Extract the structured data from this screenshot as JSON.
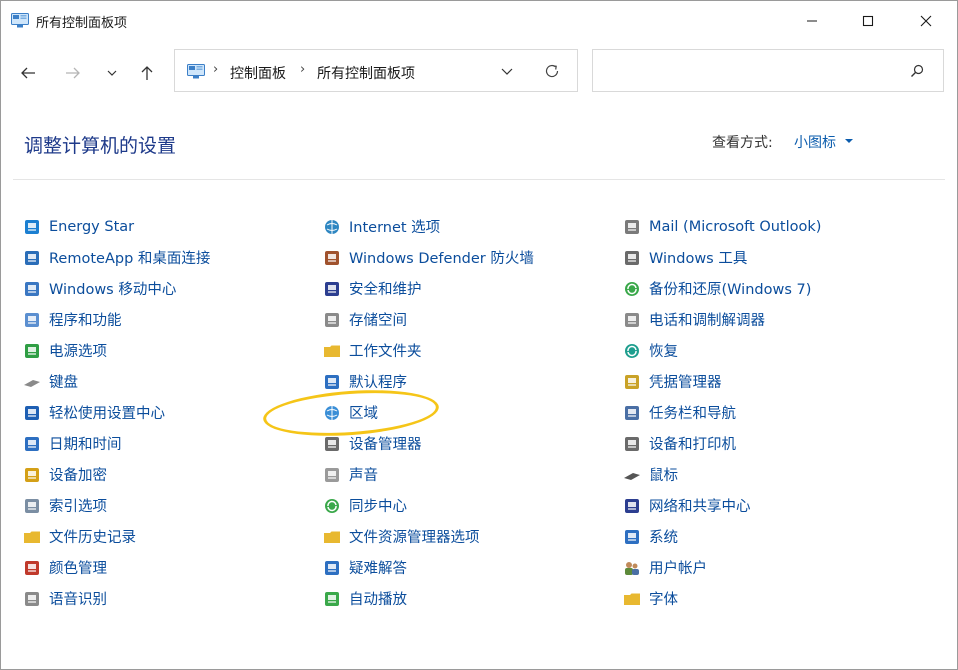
{
  "window": {
    "title": "所有控制面板项"
  },
  "address": {
    "crumbs": [
      "控制面板",
      "所有控制面板项"
    ],
    "separator": "›"
  },
  "search": {
    "placeholder": ""
  },
  "header": {
    "title": "调整计算机的设置",
    "view_label": "查看方式:",
    "view_value": "小图标"
  },
  "columns": [
    [
      {
        "label": "Energy Star",
        "icon": "energy-star-icon",
        "color": "#1b7fd1"
      },
      {
        "label": "RemoteApp 和桌面连接",
        "icon": "remoteapp-icon",
        "color": "#2a6db8"
      },
      {
        "label": "Windows 移动中心",
        "icon": "mobility-center-icon",
        "color": "#3a77c2"
      },
      {
        "label": "程序和功能",
        "icon": "programs-icon",
        "color": "#5b8fd0"
      },
      {
        "label": "电源选项",
        "icon": "power-options-icon",
        "color": "#2f9e44"
      },
      {
        "label": "键盘",
        "icon": "keyboard-icon",
        "color": "#8a8a8a"
      },
      {
        "label": "轻松使用设置中心",
        "icon": "ease-of-access-icon",
        "color": "#1e5fb3"
      },
      {
        "label": "日期和时间",
        "icon": "date-time-icon",
        "color": "#2d6fc1"
      },
      {
        "label": "设备加密",
        "icon": "device-encryption-icon",
        "color": "#d4a017"
      },
      {
        "label": "索引选项",
        "icon": "indexing-options-icon",
        "color": "#7b8ea3"
      },
      {
        "label": "文件历史记录",
        "icon": "file-history-icon",
        "color": "#e8b830"
      },
      {
        "label": "颜色管理",
        "icon": "color-management-icon",
        "color": "#c0392b"
      },
      {
        "label": "语音识别",
        "icon": "speech-recognition-icon",
        "color": "#8a8a8a"
      }
    ],
    [
      {
        "label": "Internet 选项",
        "icon": "internet-options-icon",
        "color": "#2e86c1"
      },
      {
        "label": "Windows Defender 防火墙",
        "icon": "firewall-icon",
        "color": "#a0522d"
      },
      {
        "label": "安全和维护",
        "icon": "security-maintenance-icon",
        "color": "#2c3e90"
      },
      {
        "label": "存储空间",
        "icon": "storage-spaces-icon",
        "color": "#8a8a8a"
      },
      {
        "label": "工作文件夹",
        "icon": "work-folders-icon",
        "color": "#e8b830"
      },
      {
        "label": "默认程序",
        "icon": "default-programs-icon",
        "color": "#2d6fc1"
      },
      {
        "label": "区域",
        "icon": "region-icon",
        "color": "#3a8ed6"
      },
      {
        "label": "设备管理器",
        "icon": "device-manager-icon",
        "color": "#6a6a6a"
      },
      {
        "label": "声音",
        "icon": "sound-icon",
        "color": "#9a9a9a"
      },
      {
        "label": "同步中心",
        "icon": "sync-center-icon",
        "color": "#3aa84a"
      },
      {
        "label": "文件资源管理器选项",
        "icon": "explorer-options-icon",
        "color": "#e8b830"
      },
      {
        "label": "疑难解答",
        "icon": "troubleshooting-icon",
        "color": "#2d6fc1"
      },
      {
        "label": "自动播放",
        "icon": "autoplay-icon",
        "color": "#3aa84a"
      }
    ],
    [
      {
        "label": "Mail (Microsoft Outlook)",
        "icon": "mail-icon",
        "color": "#7a7a7a"
      },
      {
        "label": "Windows 工具",
        "icon": "windows-tools-icon",
        "color": "#6a6a6a"
      },
      {
        "label": "备份和还原(Windows 7)",
        "icon": "backup-restore-icon",
        "color": "#3aa84a"
      },
      {
        "label": "电话和调制解调器",
        "icon": "phone-modem-icon",
        "color": "#8a8a8a"
      },
      {
        "label": "恢复",
        "icon": "recovery-icon",
        "color": "#1e9e8e"
      },
      {
        "label": "凭据管理器",
        "icon": "credential-manager-icon",
        "color": "#c9a227"
      },
      {
        "label": "任务栏和导航",
        "icon": "taskbar-icon",
        "color": "#4a6fa5"
      },
      {
        "label": "设备和打印机",
        "icon": "devices-printers-icon",
        "color": "#6a6a6a"
      },
      {
        "label": "鼠标",
        "icon": "mouse-icon",
        "color": "#555555"
      },
      {
        "label": "网络和共享中心",
        "icon": "network-sharing-icon",
        "color": "#2c3e90"
      },
      {
        "label": "系统",
        "icon": "system-icon",
        "color": "#2d6fc1"
      },
      {
        "label": "用户帐户",
        "icon": "user-accounts-icon",
        "color": "#5d8a3a"
      },
      {
        "label": "字体",
        "icon": "fonts-icon",
        "color": "#e8b830"
      }
    ]
  ]
}
